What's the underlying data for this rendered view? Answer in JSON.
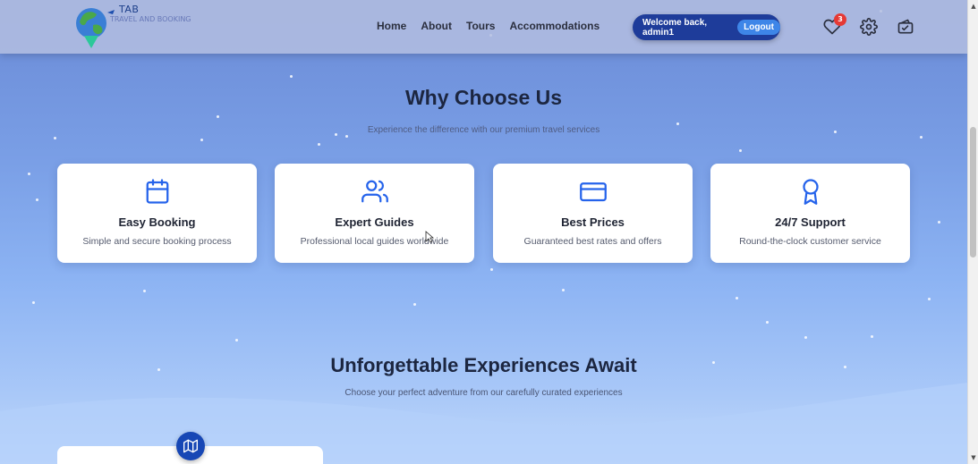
{
  "header": {
    "logo_text": "TAB",
    "logo_sub": "TRAVEL AND BOOKING",
    "nav": [
      "Home",
      "About",
      "Tours",
      "Accommodations"
    ],
    "welcome": "Welcome back, admin1",
    "logout": "Logout",
    "wishlist_count": "3",
    "icons": [
      "heart-icon",
      "gear-icon",
      "wallet-icon"
    ]
  },
  "why": {
    "title": "Why Choose Us",
    "subtitle": "Experience the difference with our premium travel services",
    "cards": [
      {
        "icon": "calendar-icon",
        "title": "Easy Booking",
        "desc": "Simple and secure booking process"
      },
      {
        "icon": "users-icon",
        "title": "Expert Guides",
        "desc": "Professional local guides worldwide"
      },
      {
        "icon": "credit-card-icon",
        "title": "Best Prices",
        "desc": "Guaranteed best rates and offers"
      },
      {
        "icon": "award-icon",
        "title": "24/7 Support",
        "desc": "Round-the-clock customer service"
      }
    ]
  },
  "experiences": {
    "title": "Unforgettable Experiences Await",
    "subtitle": "Choose your perfect adventure from our carefully curated experiences"
  },
  "colors": {
    "accent": "#1e3c9a",
    "icon_blue": "#2563eb",
    "badge": "#e53935"
  }
}
